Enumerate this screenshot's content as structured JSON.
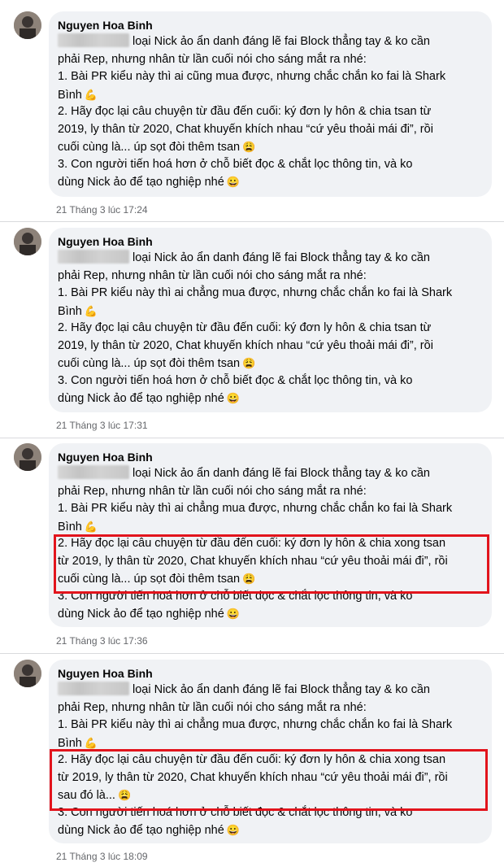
{
  "comments": [
    {
      "author": "Nguyen Hoa Binh",
      "lines": [
        "loại Nick ảo ẩn danh đáng lẽ fai Block thẳng tay & ko cần",
        "phải Rep, nhưng nhân từ lần cuối nói cho sáng mắt ra nhé:",
        "1. Bài PR kiểu này thì ai cũng mua được, nhưng chắc chắn ko fai là Shark",
        "Bình",
        "2. Hãy đọc lại câu chuyện từ đầu đến cuối: ký đơn ly hôn & chia tsan từ",
        "2019, ly thân từ 2020, Chat khuyến khích nhau “cứ yêu thoải mái đi”, rồi",
        "cuối cùng là... úp sọt đòi thêm tsan",
        "3. Con người tiến hoá hơn ở chỗ biết đọc & chắt lọc thông tin, và ko",
        "dùng Nick ảo để tạo nghiệp nhé"
      ],
      "timestamp": "21 Tháng 3 lúc 17:24"
    },
    {
      "author": "Nguyen Hoa Binh",
      "lines": [
        "loại Nick ảo ẩn danh đáng lẽ fai Block thẳng tay & ko cần",
        "phải Rep, nhưng nhân từ lần cuối nói cho sáng mắt ra nhé:",
        "1. Bài PR kiểu này thì ai chẳng mua được, nhưng chắc chắn ko fai là Shark",
        "Bình",
        "2. Hãy đọc lại câu chuyện từ đầu đến cuối: ký đơn ly hôn & chia tsan từ",
        "2019, ly thân từ 2020, Chat khuyến khích nhau “cứ yêu thoải mái đi”, rồi",
        "cuối cùng là... úp sọt đòi thêm tsan",
        "3. Con người tiến hoá hơn ở chỗ biết đọc & chắt lọc thông tin, và ko",
        "dùng Nick ảo để tạo nghiệp nhé"
      ],
      "timestamp": "21 Tháng 3 lúc 17:31"
    },
    {
      "author": "Nguyen Hoa Binh",
      "lines": [
        "loại Nick ảo ẩn danh đáng lẽ fai Block thẳng tay & ko cần",
        "phải Rep, nhưng nhân từ lần cuối nói cho sáng mắt ra nhé:",
        "1. Bài PR kiểu này thì ai chẳng mua được, nhưng chắc chắn ko fai là Shark",
        "Bình",
        "2. Hãy đọc lại câu chuyện từ đầu đến cuối: ký đơn ly hôn & chia xong tsan",
        "từ 2019, ly thân từ 2020, Chat khuyến khích nhau “cứ yêu thoải mái đi”, rồi",
        "cuối cùng là... úp sọt đòi thêm tsan",
        "3. Con người tiến hoá hơn ở chỗ biết đọc & chắt lọc thông tin, và ko",
        "dùng Nick ảo để tạo nghiệp nhé"
      ],
      "timestamp": "21 Tháng 3 lúc 17:36"
    },
    {
      "author": "Nguyen Hoa Binh",
      "lines": [
        "loại Nick ảo ẩn danh đáng lẽ fai Block thẳng tay & ko cần",
        "phải Rep, nhưng nhân từ lần cuối nói cho sáng mắt ra nhé:",
        "1. Bài PR kiểu này thì ai chẳng mua được, nhưng chắc chắn ko fai là Shark",
        "Bình",
        "2. Hãy đọc lại câu chuyện từ đầu đến cuối: ký đơn ly hôn & chia xong tsan",
        "từ 2019, ly thân từ 2020, Chat khuyến khích nhau “cứ yêu thoải mái đi”, rồi",
        "sau đó là...",
        "3. Con người tiến hoá hơn ở chỗ biết đọc & chắt lọc thông tin, và ko",
        "dùng Nick ảo để tạo nghiệp nhé"
      ],
      "timestamp": "21 Tháng 3 lúc 18:09"
    }
  ],
  "emoji": {
    "flexed_biceps": "💪",
    "shrug_face": "😩",
    "grin_face": "😀"
  },
  "colors": {
    "bubble": "#f0f2f5",
    "highlight": "#e2141c",
    "timestamp": "#65676b"
  }
}
